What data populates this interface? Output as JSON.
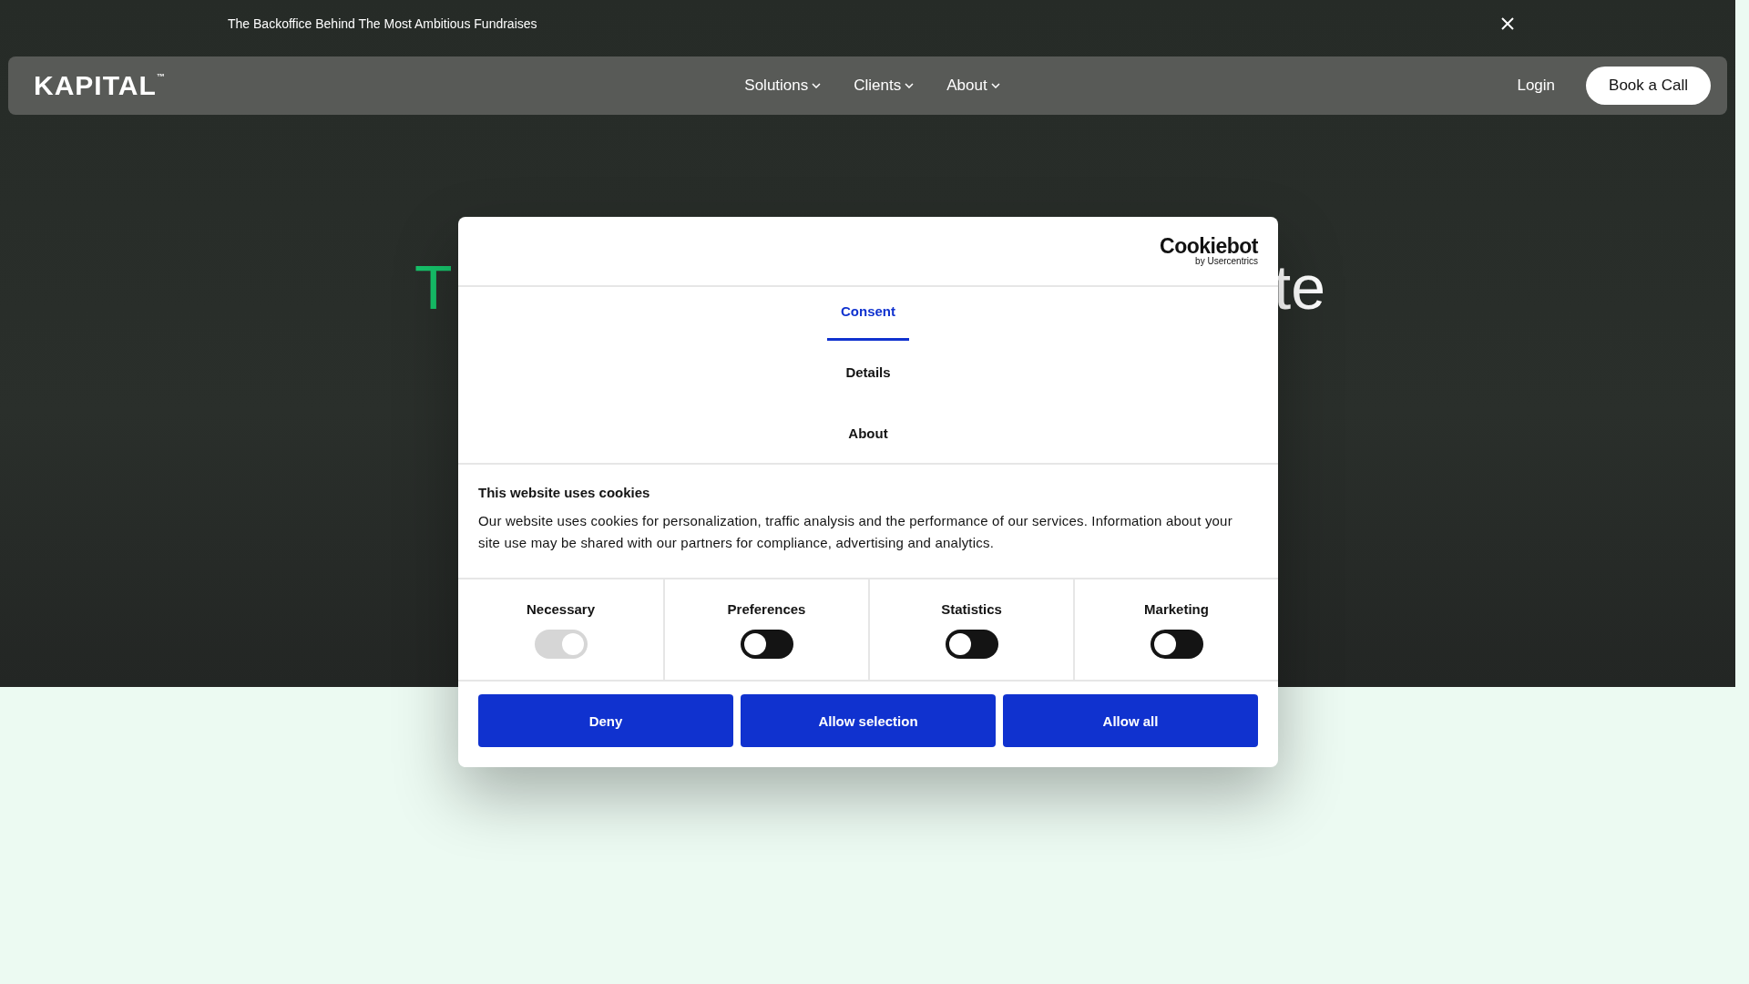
{
  "announcement": {
    "text": "The Backoffice Behind The Most Ambitious Fundraises"
  },
  "nav": {
    "logo": "KAPITAL",
    "logo_mark": "™",
    "items": [
      {
        "label": "Solutions"
      },
      {
        "label": "Clients"
      },
      {
        "label": "About"
      }
    ],
    "login": "Login",
    "cta": "Book a Call"
  },
  "hero": {
    "heading_left": "T",
    "heading_right": "te"
  },
  "cookie_dialog": {
    "brand": "Cookiebot",
    "brand_sub": "by Usercentrics",
    "tabs": [
      {
        "label": "Consent",
        "selected": true
      },
      {
        "label": "Details",
        "selected": false
      },
      {
        "label": "About",
        "selected": false
      }
    ],
    "title": "This website uses cookies",
    "text": "Our website uses cookies for personalization, traffic analysis and the performance of our services. Information about your site use may be shared with our partners for compliance, advertising and analytics.",
    "toggles": [
      {
        "label": "Necessary",
        "checked": true,
        "disabled": true
      },
      {
        "label": "Preferences",
        "checked": false,
        "disabled": false
      },
      {
        "label": "Statistics",
        "checked": false,
        "disabled": false
      },
      {
        "label": "Marketing",
        "checked": false,
        "disabled": false
      }
    ],
    "buttons": [
      "Deny",
      "Allow selection",
      "Allow all"
    ]
  }
}
